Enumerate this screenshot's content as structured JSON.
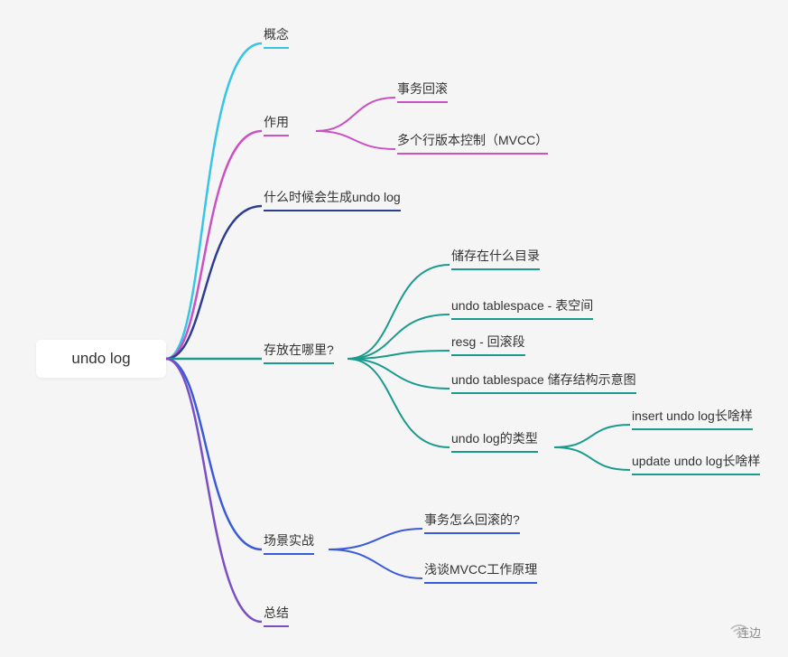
{
  "root": {
    "title": "undo log"
  },
  "level1": {
    "concept": {
      "label": "概念",
      "color": "#36c5e6"
    },
    "purpose": {
      "label": "作用",
      "color": "#c951c4"
    },
    "when": {
      "label": "什么时候会生成undo log",
      "color": "#2d3e91"
    },
    "where": {
      "label": "存放在哪里?",
      "color": "#1a9b8e"
    },
    "scenario": {
      "label": "场景实战",
      "color": "#3a5bd9"
    },
    "summary": {
      "label": "总结",
      "color": "#7a4fc4"
    }
  },
  "purpose_children": {
    "a": "事务回滚",
    "b": "多个行版本控制（MVCC）"
  },
  "where_children": {
    "a": "储存在什么目录",
    "b": "undo tablespace - 表空间",
    "c": "resg - 回滚段",
    "d": "undo tablespace 储存结构示意图",
    "e": "undo log的类型"
  },
  "undolog_type_children": {
    "a": "insert undo log长啥样",
    "b": "update undo log长啥样"
  },
  "scenario_children": {
    "a": "事务怎么回滚的?",
    "b": "浅谈MVCC工作原理"
  },
  "footer": {
    "credit": "连边"
  }
}
